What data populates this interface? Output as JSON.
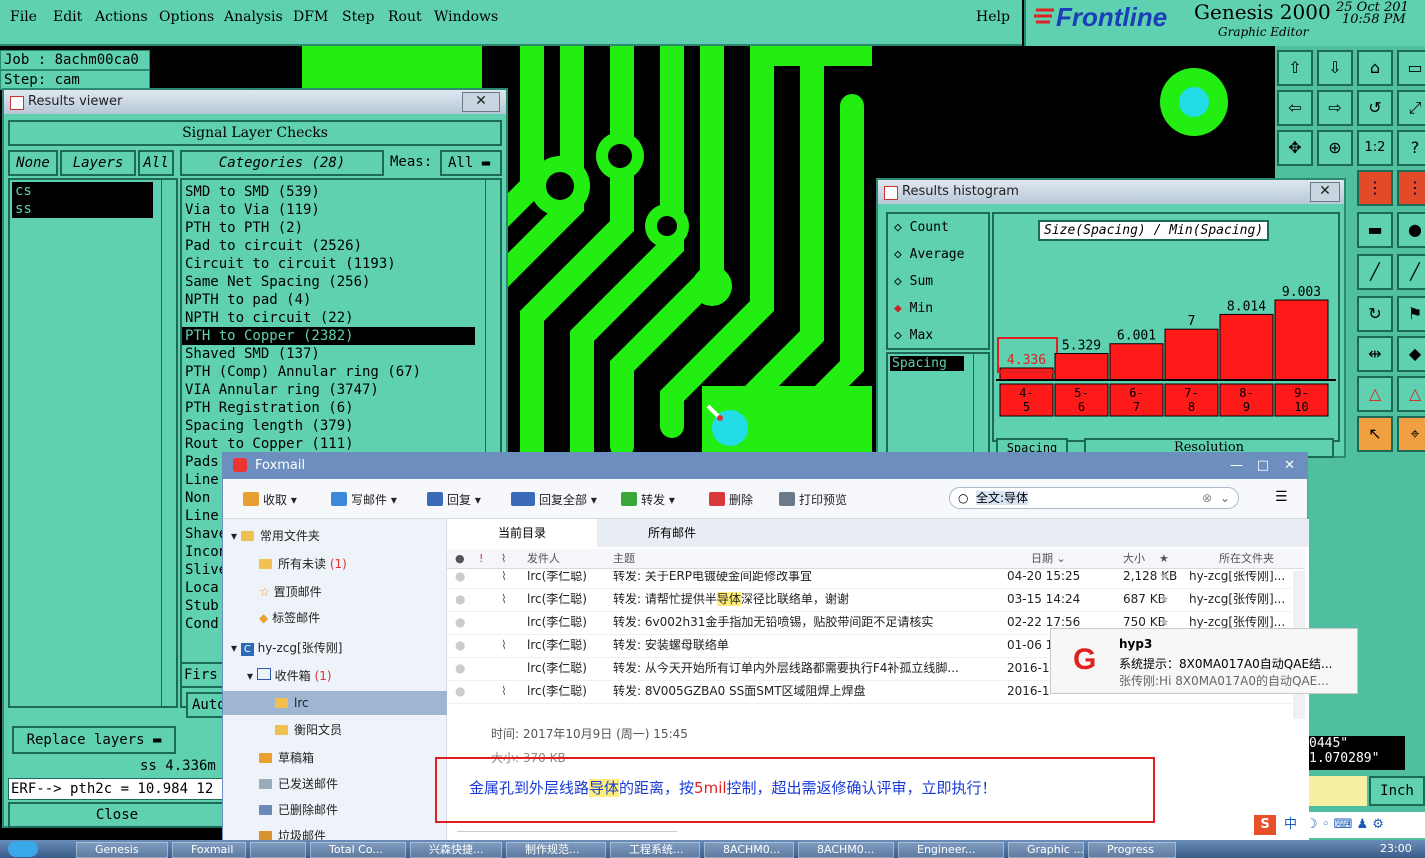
{
  "menubar": {
    "items": [
      "File",
      "Edit",
      "Actions",
      "Options",
      "Analysis",
      "DFM",
      "Step",
      "Rout",
      "Windows"
    ],
    "help": "Help",
    "brand": "Frontline",
    "app": "Genesis 2000",
    "subtitle": "Graphic Editor",
    "date": "25 Oct 201",
    "time": "10:58 PM"
  },
  "job": {
    "job": "Job : 8achm00ca0",
    "step": "Step: cam"
  },
  "results_viewer": {
    "title": "Results viewer",
    "header": "Signal Layer Checks",
    "none_btn": "None",
    "layers_btn": "Layers",
    "all_btn": "All",
    "categories_label": "Categories (28)",
    "meas_label": "Meas:",
    "meas_value": "All",
    "layers": [
      "cs",
      "ss"
    ],
    "categories": [
      "SMD to SMD (539)",
      "Via to Via (119)",
      "PTH to PTH (2)",
      "Pad to circuit (2526)",
      "Circuit to circuit (1193)",
      "Same Net Spacing (256)",
      "NPTH to pad (4)",
      "NPTH to circuit (22)",
      "PTH to Copper (2382)",
      "Shaved SMD (137)",
      "PTH (Comp) Annular ring (67)",
      "VIA Annular ring (3747)",
      "PTH Registration (6)",
      "Spacing length (379)",
      "Rout to Copper (111)",
      "Pads",
      "Line",
      "Non",
      "Line",
      "Shave",
      "Incon",
      "Slive",
      "Loca",
      "Stub",
      "Cond"
    ],
    "selected_index": 8,
    "first_btn": "Firs",
    "auto_btn": "Auto",
    "replace_btn": "Replace layers",
    "status": "ss 4.336m",
    "erf": "ERF--> pth2c = 10.984 12",
    "close_btn": "Close"
  },
  "histogram": {
    "title": "Results histogram",
    "options": [
      "Count",
      "Average",
      "Sum",
      "Min",
      "Max"
    ],
    "selected_option": "Min",
    "chart_title": "Size(Spacing) / Min(Spacing)",
    "spacing_label": "Spacing",
    "spacing_field": "Spacing",
    "resolution_label": "Resolution"
  },
  "chart_data": {
    "type": "bar",
    "title": "Size(Spacing) / Min(Spacing)",
    "categories": [
      "4-5",
      "5-6",
      "6-7",
      "7-8",
      "8-9",
      "9-10"
    ],
    "category_labels": [
      [
        "4-",
        "5"
      ],
      [
        "5-",
        "6"
      ],
      [
        "6-",
        "7"
      ],
      [
        "7-",
        "8"
      ],
      [
        "8-",
        "9"
      ],
      [
        "9-",
        "10"
      ]
    ],
    "values": [
      4.336,
      5.329,
      6.001,
      7,
      8.014,
      9.003
    ],
    "value_labels": [
      "4.336",
      "5.329",
      "6.001",
      "7",
      "8.014",
      "9.003"
    ],
    "highlight_index": 0,
    "colors": {
      "bar": "#ff1a1a",
      "highlight_box": "#e02020"
    }
  },
  "right_readouts": {
    "coord1": "0445\"",
    "coord2": "1.070289\"",
    "units": "Inch"
  },
  "foxmail": {
    "title": "Foxmail",
    "toolbar": [
      "收取",
      "写邮件",
      "回复",
      "回复全部",
      "转发",
      "删除",
      "打印预览"
    ],
    "search_value": "全文:导体",
    "tabs": [
      "当前目录",
      "所有邮件"
    ],
    "columns": [
      "发件人",
      "主题",
      "日期",
      "大小",
      "所在文件夹"
    ],
    "sidebar": [
      {
        "label": "常用文件夹"
      },
      {
        "label": "所有未读",
        "count": "(1)"
      },
      {
        "label": "置顶邮件"
      },
      {
        "label": "标签邮件"
      },
      {
        "label": "hy-zcg[张传刚]"
      },
      {
        "label": "收件箱",
        "count": "(1)"
      },
      {
        "label": "lrc"
      },
      {
        "label": "衡阳文员"
      },
      {
        "label": "草稿箱"
      },
      {
        "label": "已发送邮件"
      },
      {
        "label": "已删除邮件"
      },
      {
        "label": "垃圾邮件"
      }
    ],
    "rows": [
      {
        "from": "lrc(李仁聪)",
        "subject": "转发: 关于ERP电镀硬金间距修改事宜",
        "date": "04-20 15:25",
        "size": "2,128 KB",
        "folder": "hy-zcg[张传刚]..."
      },
      {
        "from": "lrc(李仁聪)",
        "subject_pre": "转发: 请帮忙提供半",
        "subject_hl": "导体",
        "subject_post": "深径比联络单，谢谢",
        "date": "03-15 14:24",
        "size": "687 KB",
        "folder": "hy-zcg[张传刚]..."
      },
      {
        "from": "lrc(李仁聪)",
        "subject": "转发: 6v002h31金手指加无铅喷锡，贴胶带间距不足请核实",
        "date": "02-22 17:56",
        "size": "750 KB",
        "folder": "hy-zcg[张传刚]..."
      },
      {
        "from": "lrc(李仁聪)",
        "subject": "转发: 安装螺母联络单",
        "date": "01-06 1"
      },
      {
        "from": "lrc(李仁聪)",
        "subject": "转发: 从今天开始所有订单内外层线路都需要执行F4补孤立线脚...",
        "date": "2016-1"
      },
      {
        "from": "lrc(李仁聪)",
        "subject": "转发: 8V005GZBA0  SS面SMT区域阻焊上焊盘",
        "date": "2016-1"
      }
    ],
    "preview_time": "时间: 2017年10月9日 (周一) 15:45",
    "preview_size": "大小: 370 KB",
    "body_pre": "金属孔到外层线路",
    "body_hl": "导体",
    "body_mid": "的距离，按",
    "body_red": "5mil",
    "body_post": "控制，超出需返修确认评审，立即执行！"
  },
  "notification": {
    "title": "hyp3",
    "line1": "系统提示：8X0MA017A0自动QAE结...",
    "line2": "张传刚:Hi 8X0MA017A0的自动QAE..."
  },
  "taskbar": {
    "items": [
      "Genesis",
      "Foxmail",
      "",
      "Total Co...",
      "兴森快捷...",
      "制作规范...",
      "工程系统...",
      "8ACHM0...",
      "8ACHM0...",
      "Engineer...",
      "Graphic ...",
      "Progress"
    ],
    "ime": "中",
    "clock": "23:00"
  }
}
